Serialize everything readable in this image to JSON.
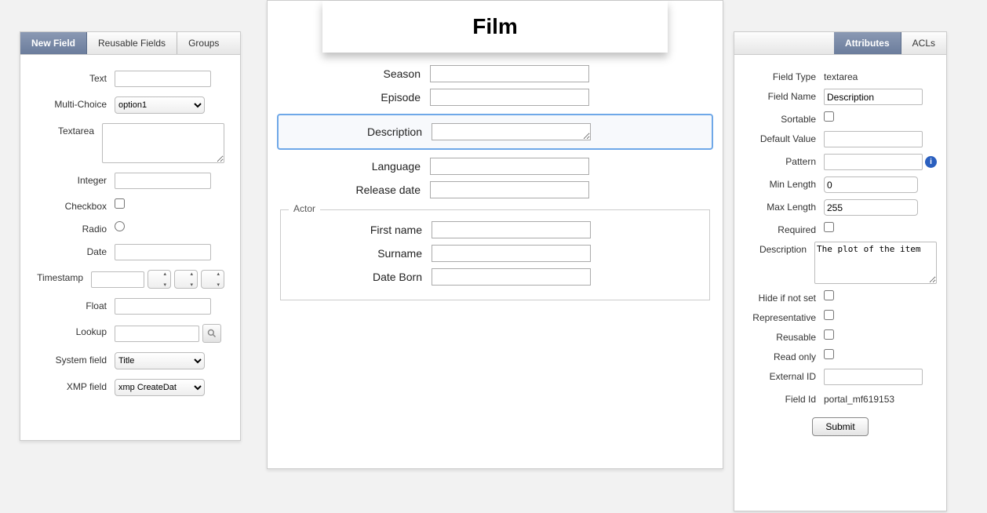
{
  "left": {
    "tabs": [
      "New Field",
      "Reusable Fields",
      "Groups"
    ],
    "active_tab": 0,
    "fields": {
      "text_label": "Text",
      "multichoice_label": "Multi-Choice",
      "multichoice_value": "option1",
      "textarea_label": "Textarea",
      "integer_label": "Integer",
      "checkbox_label": "Checkbox",
      "radio_label": "Radio",
      "date_label": "Date",
      "timestamp_label": "Timestamp",
      "float_label": "Float",
      "lookup_label": "Lookup",
      "system_label": "System field",
      "system_value": "Title",
      "xmp_label": "XMP field",
      "xmp_value": "xmp CreateDat"
    }
  },
  "center": {
    "title": "Film",
    "rows": {
      "season": "Season",
      "episode": "Episode",
      "description": "Description",
      "language": "Language",
      "release_date": "Release date"
    },
    "actor": {
      "legend": "Actor",
      "first_name": "First name",
      "surname": "Surname",
      "date_born": "Date Born"
    },
    "selected_field": "description"
  },
  "right": {
    "tabs": [
      "Attributes",
      "ACLs"
    ],
    "active_tab": 0,
    "field_type_label": "Field Type",
    "field_type_value": "textarea",
    "field_name_label": "Field Name",
    "field_name_value": "Description",
    "sortable_label": "Sortable",
    "sortable_value": false,
    "default_value_label": "Default Value",
    "default_value": "",
    "pattern_label": "Pattern",
    "pattern_value": "",
    "min_length_label": "Min Length",
    "min_length_value": "0",
    "max_length_label": "Max Length",
    "max_length_value": "255",
    "required_label": "Required",
    "required_value": false,
    "description_label": "Description",
    "description_value": "The plot of the item",
    "hide_if_not_set_label": "Hide if not set",
    "hide_if_not_set_value": false,
    "representative_label": "Representative",
    "representative_value": false,
    "reusable_label": "Reusable",
    "reusable_value": false,
    "read_only_label": "Read only",
    "read_only_value": false,
    "external_id_label": "External ID",
    "external_id_value": "",
    "field_id_label": "Field Id",
    "field_id_value": "portal_mf619153",
    "submit_label": "Submit"
  }
}
